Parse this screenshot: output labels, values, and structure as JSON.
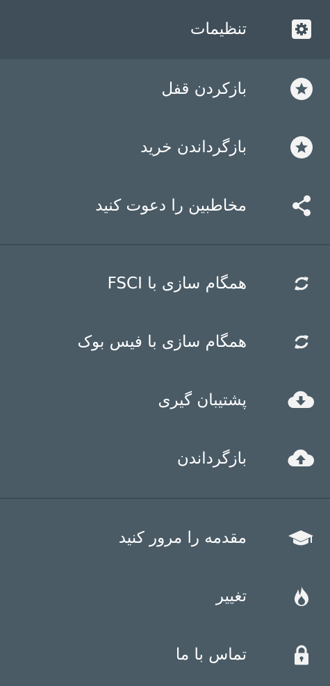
{
  "colors": {
    "background": "#4a5b66",
    "header_background": "#3f4e58",
    "divider": "#3c4a53",
    "text": "#ffffff",
    "icon": "#f3f3f3"
  },
  "menu": {
    "items": [
      {
        "label": "تنظیمات",
        "icon": "gear-icon"
      },
      {
        "label": "بازکردن قفل",
        "icon": "star-circle-icon"
      },
      {
        "label": "بازگرداندن خرید",
        "icon": "star-circle-icon"
      },
      {
        "label": "مخاطبین را دعوت کنید",
        "icon": "share-icon"
      },
      {
        "label": "همگام سازی با FSCI",
        "icon": "sync-icon"
      },
      {
        "label": "همگام سازی با فیس بوک",
        "icon": "sync-icon"
      },
      {
        "label": "پشتیبان گیری",
        "icon": "cloud-download-icon"
      },
      {
        "label": "بازگرداندن",
        "icon": "cloud-upload-icon"
      },
      {
        "label": "مقدمه را مرور کنید",
        "icon": "graduation-cap-icon"
      },
      {
        "label": "تغییر",
        "icon": "flame-icon"
      },
      {
        "label": "تماس با ما",
        "icon": "lock-icon"
      }
    ]
  }
}
